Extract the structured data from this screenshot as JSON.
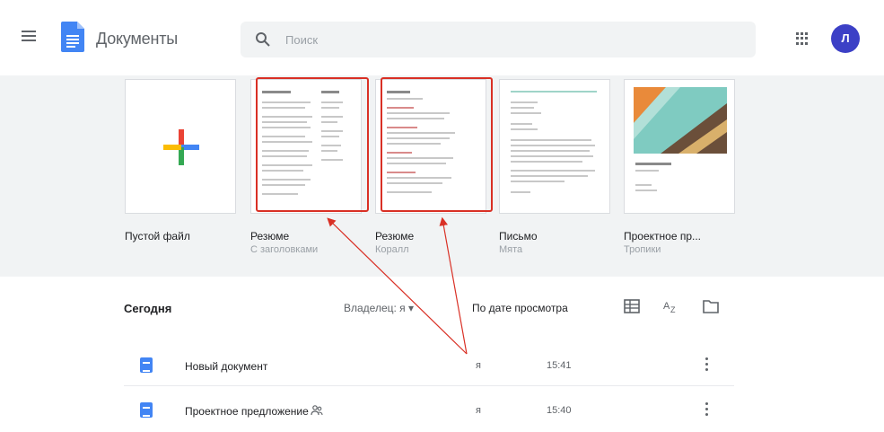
{
  "header": {
    "menu_icon": "hamburger-menu-icon",
    "logo_icon": "docs-logo-icon",
    "app_title": "Документы",
    "search": {
      "placeholder": "Поиск",
      "icon": "search-icon"
    },
    "apps_icon": "apps-grid-icon",
    "avatar_letter": "Л",
    "avatar_color": "#3c40c6"
  },
  "templates": [
    {
      "name": "Пустой файл",
      "subtitle": ""
    },
    {
      "name": "Резюме",
      "subtitle": "С заголовками"
    },
    {
      "name": "Резюме",
      "subtitle": "Коралл"
    },
    {
      "name": "Письмо",
      "subtitle": "Мята"
    },
    {
      "name": "Проектное пр...",
      "subtitle": "Тропики"
    }
  ],
  "recent": {
    "section_title": "Сегодня",
    "owner_filter": "Владелец: я ▾",
    "sort_label": "По дате просмотра",
    "view_icons": [
      "grid-view-icon",
      "sort-az-icon",
      "folder-icon"
    ],
    "documents": [
      {
        "title": "Новый документ",
        "owner": "я",
        "time": "15:41",
        "shared": false
      },
      {
        "title": "Проектное предложение",
        "owner": "я",
        "time": "15:40",
        "shared": true
      }
    ]
  },
  "colors": {
    "highlight": "#d93025",
    "accent": "#4285f4",
    "gallery_bg": "#f1f3f4"
  }
}
